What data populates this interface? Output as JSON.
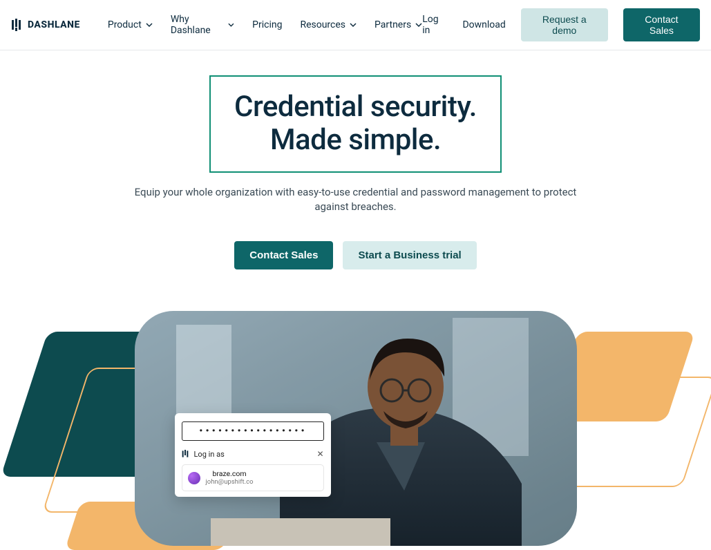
{
  "brand": "DASHLANE",
  "nav": {
    "items": [
      {
        "label": "Product",
        "has_dropdown": true
      },
      {
        "label": "Why Dashlane",
        "has_dropdown": true
      },
      {
        "label": "Pricing",
        "has_dropdown": false
      },
      {
        "label": "Resources",
        "has_dropdown": true
      },
      {
        "label": "Partners",
        "has_dropdown": true
      }
    ],
    "login": "Log in",
    "download": "Download",
    "request_demo": "Request a demo",
    "contact_sales": "Contact Sales"
  },
  "hero": {
    "headline_line1": "Credential security.",
    "headline_line2": "Made simple.",
    "sub": "Equip your whole organization with easy-to-use credential and password management to protect against breaches.",
    "cta_primary": "Contact Sales",
    "cta_secondary": "Start a Business trial"
  },
  "overlay": {
    "password_dots": "•••••••••••••••••",
    "login_as": "Log in as",
    "account_domain": "braze.com",
    "account_email": "john@upshift.co"
  },
  "colors": {
    "teal_dark": "#0d4b4f",
    "teal_btn": "#0e6668",
    "teal_light": "#cfe5e5",
    "accent": "#0f8f74",
    "orange": "#f3b66a"
  }
}
